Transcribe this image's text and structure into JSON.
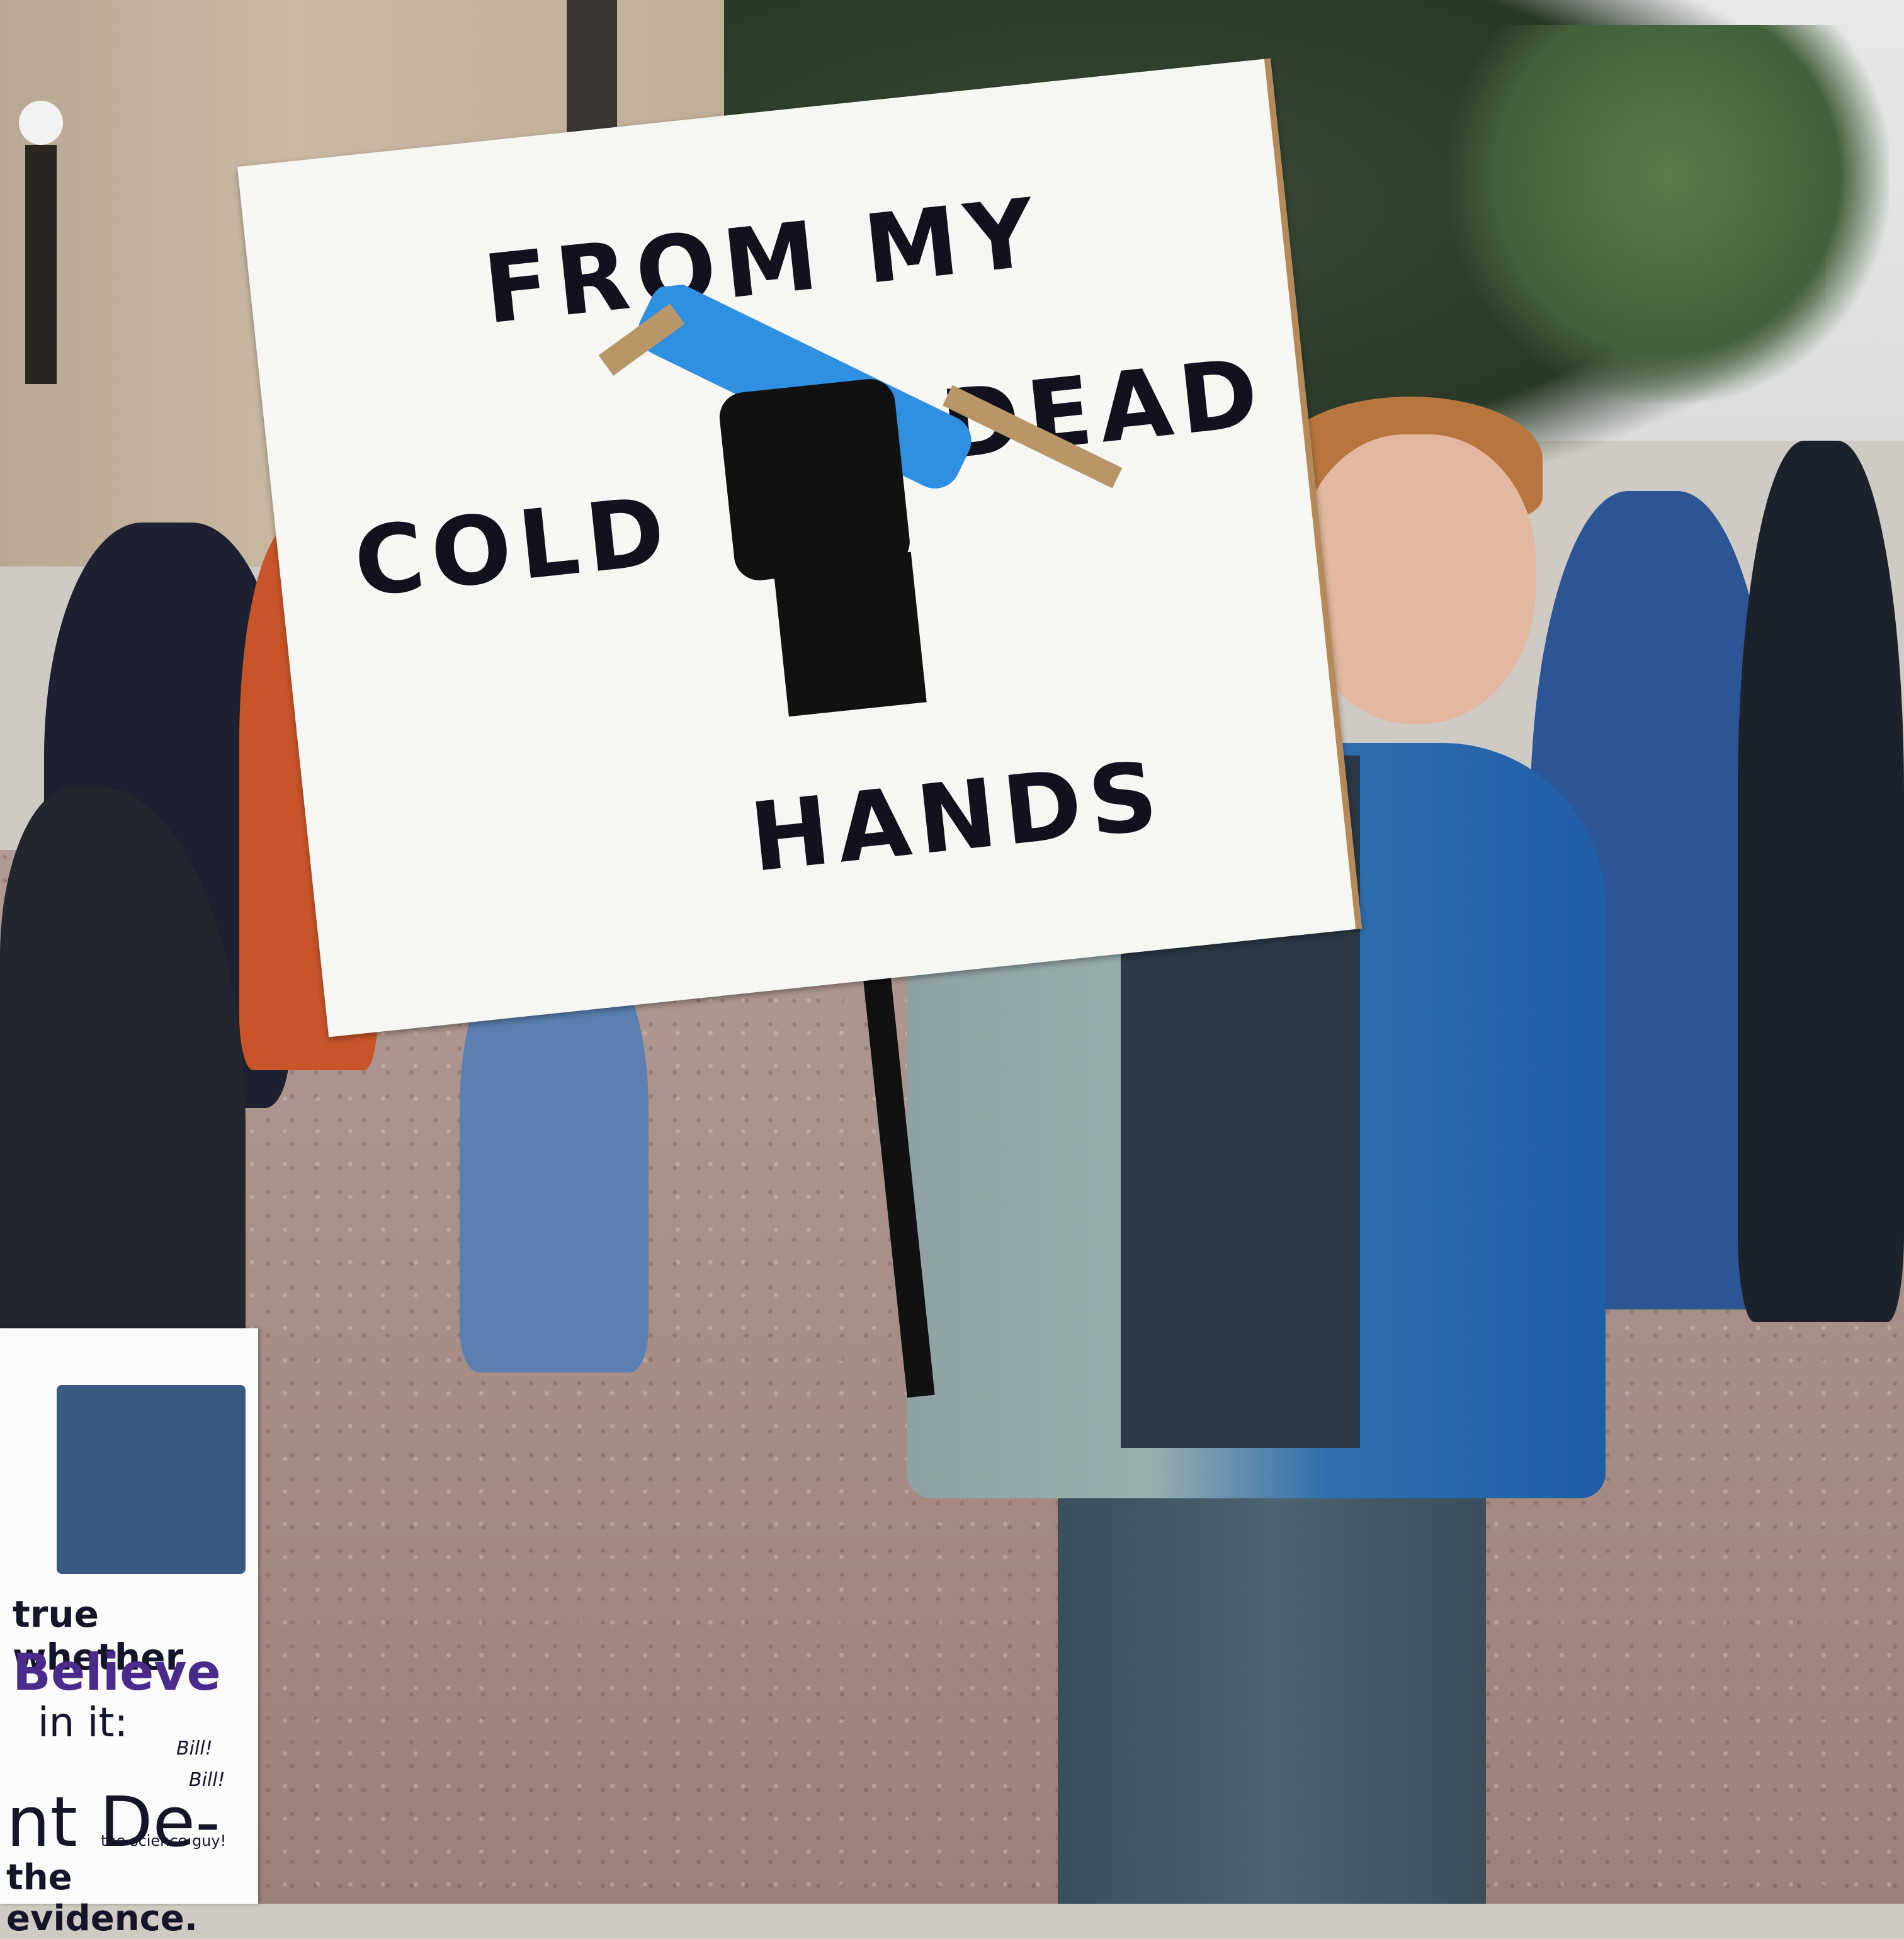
{
  "scene": {
    "description_colors": {
      "sign_background": "#f6f6f3",
      "sign_text": "#12121e",
      "pipette_blue": "#2f8fe0",
      "jacket_blue": "#1f5ea8"
    }
  },
  "main_sign": {
    "line1": "FROM MY",
    "line2a": "COLD",
    "line2b": "DEAD",
    "line3": "HANDS"
  },
  "left_sign": {
    "line1": "true whether",
    "line2": "Believe",
    "line3": "in it:",
    "line4": "Bill!",
    "line5": "nt De-",
    "line6": "Bill!",
    "line7": "the evidence.",
    "line8": "the science guy!"
  }
}
